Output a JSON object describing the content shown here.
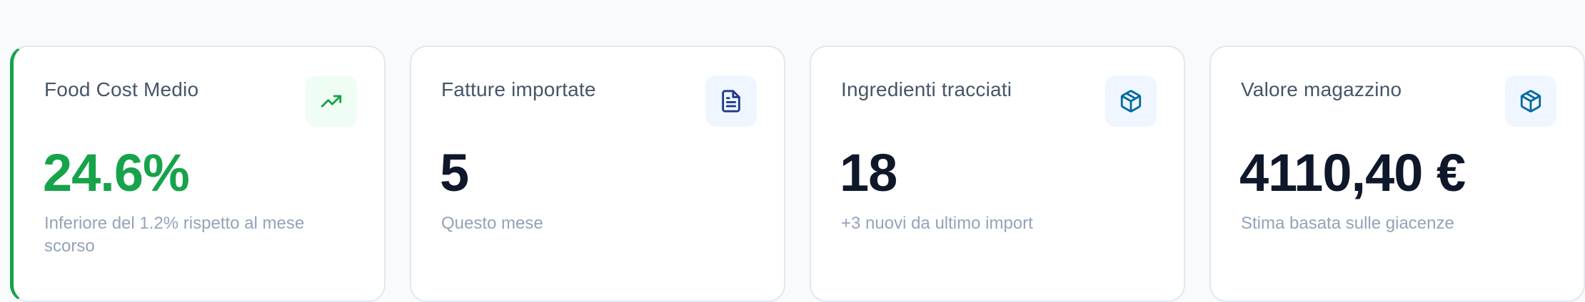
{
  "cards": [
    {
      "title": "Food Cost Medio",
      "value": "24.6%",
      "subtitle": "Inferiore del 1.2% rispetto al mese scorso",
      "icon": "trending-up-icon",
      "accent": "#16a34a"
    },
    {
      "title": "Fatture importate",
      "value": "5",
      "subtitle": "Questo mese",
      "icon": "document-icon",
      "accent": "#1e40af"
    },
    {
      "title": "Ingredienti tracciati",
      "value": "18",
      "subtitle": "+3 nuovi da ultimo import",
      "icon": "package-icon",
      "accent": "#0369a1"
    },
    {
      "title": "Valore magazzino",
      "value": "4110,40 €",
      "subtitle": "Stima basata sulle giacenze",
      "icon": "package-icon",
      "accent": "#0369a1"
    }
  ]
}
